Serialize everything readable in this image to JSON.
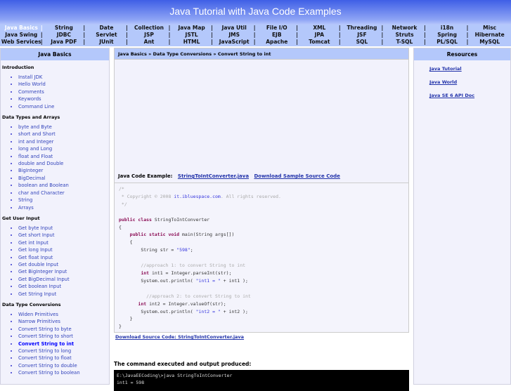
{
  "title": "Java Tutorial with Java Code Examples",
  "nav": [
    [
      "Java Basics",
      "String",
      "Date",
      "Collection",
      "Java Map",
      "Java Util",
      "File I/O",
      "XML",
      "Threading",
      "Network",
      "i18n",
      "Misc"
    ],
    [
      "Java Swing",
      "JDBC",
      "Servlet",
      "JSP",
      "JSTL",
      "JMS",
      "EJB",
      "JPA",
      "JSF",
      "Struts",
      "Spring",
      "Hibernate"
    ],
    [
      "Web Services",
      "Java PDF",
      "JUnit",
      "Ant",
      "HTML",
      "JavaScript",
      "Apache",
      "Tomcat",
      "SQL",
      "T-SQL",
      "PL/SQL",
      "MySQL"
    ]
  ],
  "sidebar": {
    "title": "Java Basics",
    "sections": [
      {
        "title": "Introduction",
        "items": [
          "Install JDK",
          "Hello World",
          "Comments",
          "Keywords",
          "Command Line"
        ]
      },
      {
        "title": "Data Types and Arrays",
        "items": [
          "byte and Byte",
          "short and Short",
          "int and Integer",
          "long and Long",
          "float and Float",
          "double and Double",
          "BigInteger",
          "BigDecimal",
          "boolean and Boolean",
          "char and Character",
          "String",
          "Arrays"
        ]
      },
      {
        "title": "Get User Input",
        "items": [
          "Get byte Input",
          "Get short Input",
          "Get int Input",
          "Get long Input",
          "Get float Input",
          "Get double Input",
          "Get BigInteger Input",
          "Get BigDecimal Input",
          "Get boolean Input",
          "Get String Input"
        ]
      },
      {
        "title": "Data Type Conversions",
        "items": [
          "Widen Primitives",
          "Narrow Primitives",
          "Convert String to byte",
          "Convert String to short",
          "Convert String to int",
          "Convert String to long",
          "Convert String to float",
          "Convert String to double",
          "Convert String to boolean"
        ]
      }
    ],
    "current": "Convert String to int"
  },
  "main": {
    "breadcrumb": "Java Basics » Data Type Conversions » Convert String to int",
    "example_label": "Java Code Example:",
    "example_file": "StringToIntConverter.java",
    "download_sample": "Download Sample Source Code",
    "code": {
      "c1": "/*",
      "c2": " * Copyright © 2008 ",
      "c2link": "it.ibluespace.com",
      "c2b": ". All rights reserved.",
      "c3": " */",
      "kw_pc": "public class",
      "cls": " StringToIntConverter",
      "kw_psv": "public static void",
      "main": " main(String args[])",
      "str_decl": "String str = ",
      "str_val": "\"598\"",
      "cm1": "//approach 1: to convert String to int",
      "kw_int": "int",
      "l1": " int1 = Integer.parseInt(str);",
      "p1a": "System.out.println( ",
      "p1s": "\"int1 = \"",
      "p1b": " + int1 );",
      "cm2": "//approach 2: to convert String to int",
      "l2": " int2 = Integer.valueOf(str);",
      "p2s": "\"int2 = \"",
      "p2b": " + int2 );"
    },
    "download_source": "Download Source Code: StringToIntConverter.java",
    "output_label": "The command executed and output produced:",
    "terminal": [
      "E:\\JavaEECoding\\>java StringToIntConverter",
      "int1 = 598"
    ]
  },
  "resources": {
    "title": "Resources",
    "links": [
      "Java Tutorial",
      "Java World",
      "Java SE 6 API Doc"
    ]
  }
}
